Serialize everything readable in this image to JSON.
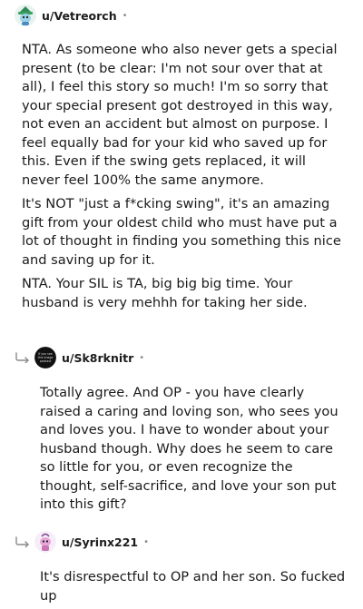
{
  "comments": [
    {
      "username": "u/Vetreorch",
      "separator": "•",
      "avatar_icon": "snoo-avatar-green-hat-icon",
      "paragraphs": [
        "NTA. As someone who also never gets a special present (to be clear: I'm not sour over that at all), I feel this story so much! I'm so sorry that your special present got destroyed in this way, not even an accident but almost on purpose. I feel equally bad for your kid who saved up for this. Even if the swing gets replaced, it will never feel 100% the same anymore.",
        "It's NOT \"just a f*cking swing\", it's an amazing gift from your oldest child who must have put a lot of thought in finding you something this nice and saving up for it.",
        "NTA. Your SIL is TA, big big big time. Your husband is very mehhh for taking her side."
      ]
    },
    {
      "username": "u/Sk8rknitr",
      "separator": "•",
      "avatar_icon": "dark-meme-avatar-icon",
      "avatar_text": "If you see this image podcast",
      "paragraphs": [
        "Totally agree. And OP - you have clearly raised a caring and loving son, who sees you and loves you. I have to wonder about your husband though. Why does he seem to care so little for you, or even recognize the thought, self-sacrifice, and love your son put into this gift?"
      ]
    },
    {
      "username": "u/Syrinx221",
      "separator": "•",
      "avatar_icon": "snoo-avatar-pink-icon",
      "paragraphs": [
        "It's disrespectful to OP and her son. So fucked up"
      ]
    }
  ]
}
